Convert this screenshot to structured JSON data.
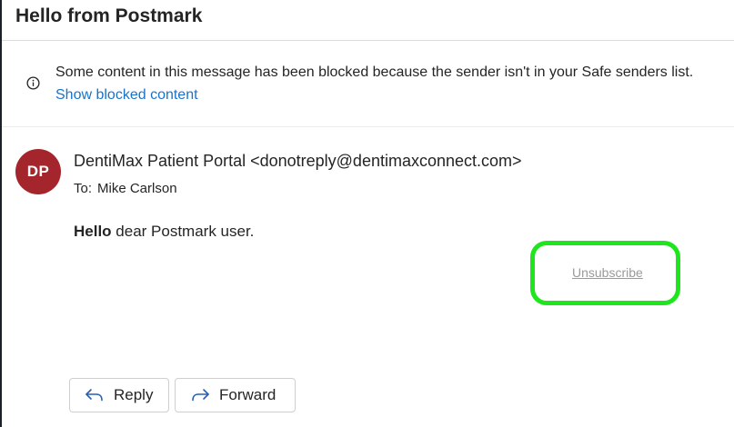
{
  "email": {
    "subject": "Hello from Postmark",
    "blocked_notice": "Some content in this message has been blocked because the sender isn't in your Safe senders list.",
    "show_blocked_link": "Show blocked content",
    "sender_initials": "DP",
    "sender_display": "DentiMax Patient Portal <donotreply@dentimaxconnect.com>",
    "to_label": "To:",
    "to_name": "Mike Carlson",
    "greeting_bold": "Hello",
    "greeting_rest": " dear Postmark user.",
    "unsubscribe_link": "Unsubscribe"
  },
  "actions": {
    "reply_label": "Reply",
    "forward_label": "Forward"
  },
  "colors": {
    "avatar_bg": "#a4262c",
    "link": "#1a73c9",
    "highlight": "#1ee51e"
  },
  "icons": {
    "info": "info-circle-icon",
    "reply": "reply-arrow-icon",
    "forward": "forward-arrow-icon"
  }
}
